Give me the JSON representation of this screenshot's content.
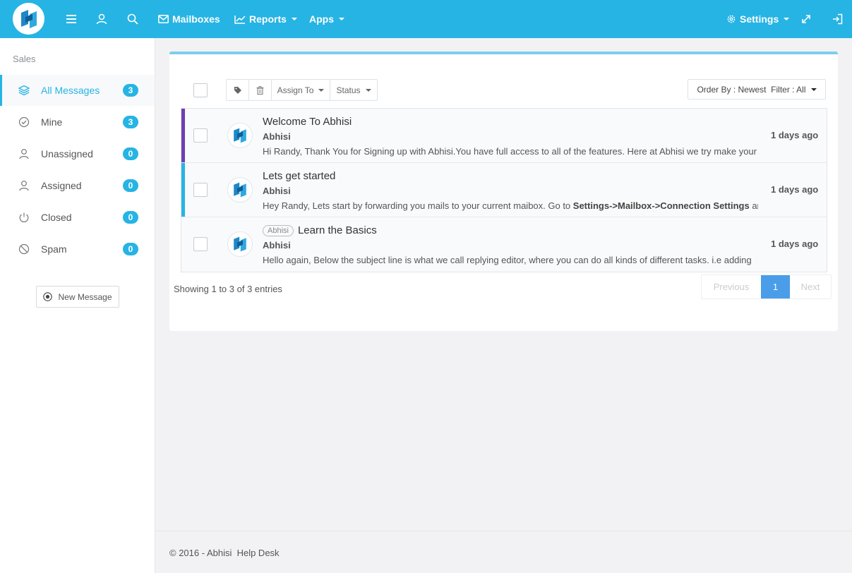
{
  "topbar": {
    "mailboxes_label": "Mailboxes",
    "reports_label": "Reports",
    "apps_label": "Apps",
    "settings_label": "Settings"
  },
  "sidebar": {
    "heading": "Sales",
    "items": [
      {
        "label": "All Messages",
        "count": "3",
        "icon": "layers-icon"
      },
      {
        "label": "Mine",
        "count": "3",
        "icon": "check-circle-icon"
      },
      {
        "label": "Unassigned",
        "count": "0",
        "icon": "user-icon"
      },
      {
        "label": "Assigned",
        "count": "0",
        "icon": "user-icon"
      },
      {
        "label": "Closed",
        "count": "0",
        "icon": "power-icon"
      },
      {
        "label": "Spam",
        "count": "0",
        "icon": "ban-icon"
      }
    ],
    "new_message_label": "New Message"
  },
  "toolbar": {
    "assign_label": "Assign To",
    "status_label": "Status",
    "order_label": "Order By : Newest  Filter : All"
  },
  "messages": [
    {
      "subject": "Welcome To Abhisi",
      "sender": "Abhisi",
      "preview": "Hi Randy, Thank You for Signing up with Abhisi.You have full access to all of the features.  Here at Abhisi we try make your",
      "time": "1 days ago",
      "accent": "#6b3fb5"
    },
    {
      "subject": "Lets get started",
      "sender": "Abhisi",
      "preview_start": "Hey Randy, Lets start by forwarding you mails to your current maibox. Go to ",
      "preview_bold": "Settings->Mailbox->Connection Settings",
      "preview_end": " and",
      "time": "1 days ago",
      "accent": "#26b4e4"
    },
    {
      "tag": "Abhisi",
      "subject": "Learn the Basics",
      "sender": "Abhisi",
      "preview": "Hello again, Below the subject line is what we call replying editor, where you can do all kinds of different tasks. i.e adding",
      "time": "1 days ago",
      "accent": ""
    }
  ],
  "showing_text": "Showing 1 to 3 of 3 entries",
  "pagination": {
    "previous": "Previous",
    "current": "1",
    "next": "Next"
  },
  "footer_text": "© 2016 - Abhisi  Help Desk",
  "colors": {
    "brand": "#26b4e4",
    "active_page": "#4a9de8"
  }
}
